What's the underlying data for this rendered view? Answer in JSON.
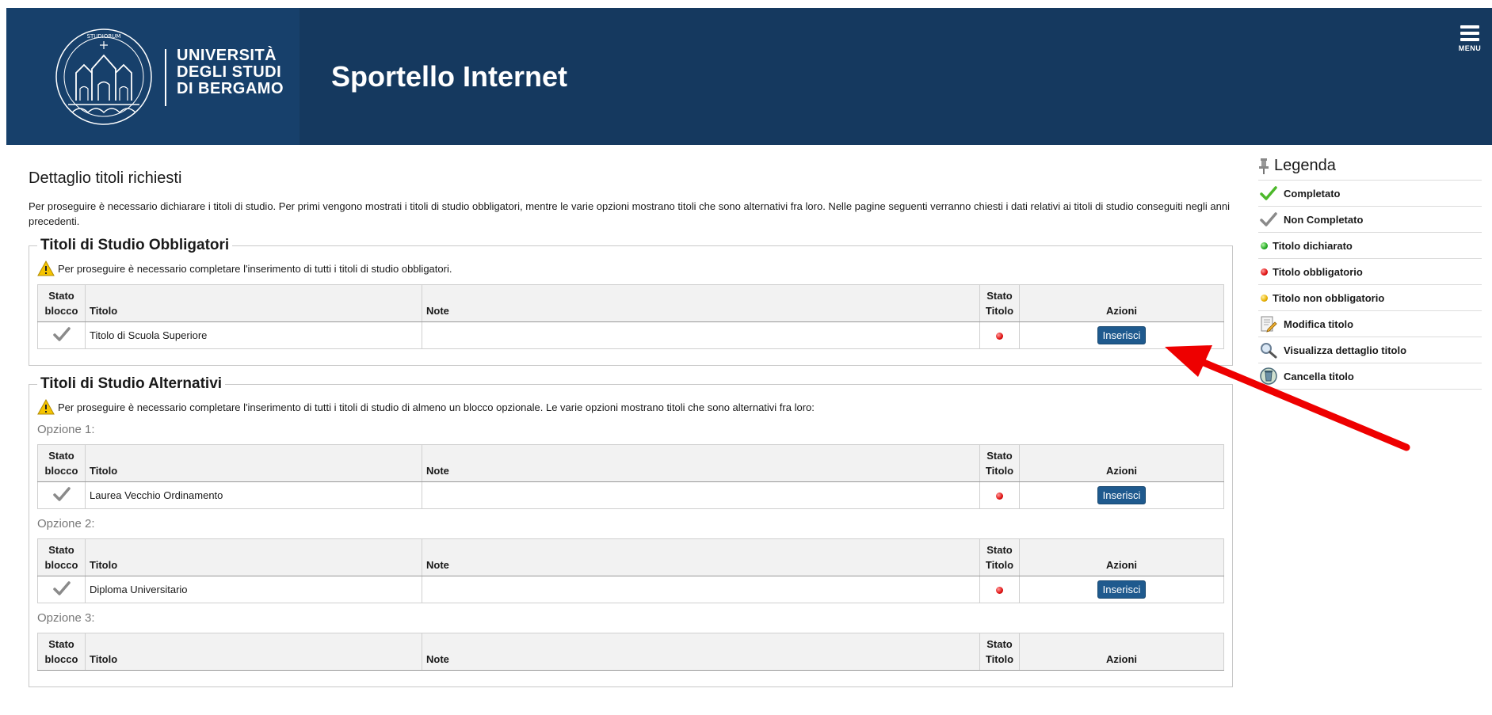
{
  "header": {
    "logo_line1": "UNIVERSITÀ",
    "logo_line2": "DEGLI STUDI",
    "logo_line3": "DI BERGAMO",
    "app_title": "Sportello Internet",
    "menu_label": "MENU"
  },
  "main": {
    "page_title": "Dettaglio titoli richiesti",
    "intro": "Per proseguire è necessario dichiarare i titoli di studio. Per primi vengono mostrati i titoli di studio obbligatori, mentre le varie opzioni mostrano titoli che sono alternativi fra loro. Nelle pagine seguenti verranno chiesti i dati relativi ai titoli di studio conseguiti negli anni precedenti.",
    "columns": {
      "stato_blocco_1": "Stato",
      "stato_blocco_2": "blocco",
      "titolo": "Titolo",
      "note": "Note",
      "stato_titolo_1": "Stato",
      "stato_titolo_2": "Titolo",
      "azioni": "Azioni"
    },
    "obbligatori": {
      "legend": "Titoli di Studio Obbligatori",
      "warning": "Per proseguire è necessario completare l'inserimento di tutti i titoli di studio obbligatori.",
      "rows": [
        {
          "titolo": "Titolo di Scuola Superiore",
          "note": "",
          "action": "Inserisci",
          "stato_color": "#e01010"
        }
      ]
    },
    "alternativi": {
      "legend": "Titoli di Studio Alternativi",
      "warning": "Per proseguire è necessario completare l'inserimento di tutti i titoli di studio di almeno un blocco opzionale. Le varie opzioni mostrano titoli che sono alternativi fra loro:",
      "options": [
        {
          "label": "Opzione 1:",
          "titolo": "Laurea Vecchio Ordinamento",
          "note": "",
          "action": "Inserisci"
        },
        {
          "label": "Opzione 2:",
          "titolo": "Diploma Universitario",
          "note": "",
          "action": "Inserisci"
        },
        {
          "label": "Opzione 3:"
        }
      ]
    }
  },
  "legenda": {
    "title": "Legenda",
    "items": [
      {
        "icon": "check-green-icon",
        "label": "Completato"
      },
      {
        "icon": "check-grey-icon",
        "label": "Non Completato"
      },
      {
        "icon": "green-dot-icon",
        "label": "Titolo dichiarato"
      },
      {
        "icon": "red-dot-icon",
        "label": "Titolo obbligatorio"
      },
      {
        "icon": "yellow-dot-icon",
        "label": "Titolo non obbligatorio"
      },
      {
        "icon": "edit-icon",
        "label": "Modifica titolo"
      },
      {
        "icon": "magnifier-icon",
        "label": "Visualizza dettaglio titolo"
      },
      {
        "icon": "delete-icon",
        "label": "Cancella titolo"
      }
    ]
  },
  "colors": {
    "header_bg": "#15395f",
    "logo_bg": "#17406b",
    "button_bg": "#1f5a8e",
    "annotation_arrow": "#ee0000"
  }
}
